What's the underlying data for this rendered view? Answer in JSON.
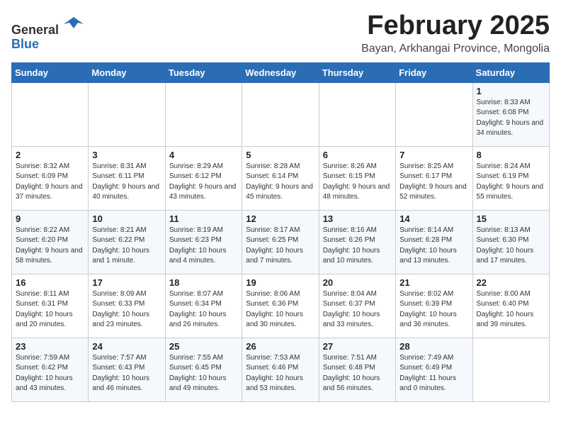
{
  "header": {
    "logo_general": "General",
    "logo_blue": "Blue",
    "month_title": "February 2025",
    "location": "Bayan, Arkhangai Province, Mongolia"
  },
  "days_of_week": [
    "Sunday",
    "Monday",
    "Tuesday",
    "Wednesday",
    "Thursday",
    "Friday",
    "Saturday"
  ],
  "weeks": [
    [
      {
        "day": "",
        "info": ""
      },
      {
        "day": "",
        "info": ""
      },
      {
        "day": "",
        "info": ""
      },
      {
        "day": "",
        "info": ""
      },
      {
        "day": "",
        "info": ""
      },
      {
        "day": "",
        "info": ""
      },
      {
        "day": "1",
        "info": "Sunrise: 8:33 AM\nSunset: 6:08 PM\nDaylight: 9 hours and 34 minutes."
      }
    ],
    [
      {
        "day": "2",
        "info": "Sunrise: 8:32 AM\nSunset: 6:09 PM\nDaylight: 9 hours and 37 minutes."
      },
      {
        "day": "3",
        "info": "Sunrise: 8:31 AM\nSunset: 6:11 PM\nDaylight: 9 hours and 40 minutes."
      },
      {
        "day": "4",
        "info": "Sunrise: 8:29 AM\nSunset: 6:12 PM\nDaylight: 9 hours and 43 minutes."
      },
      {
        "day": "5",
        "info": "Sunrise: 8:28 AM\nSunset: 6:14 PM\nDaylight: 9 hours and 45 minutes."
      },
      {
        "day": "6",
        "info": "Sunrise: 8:26 AM\nSunset: 6:15 PM\nDaylight: 9 hours and 48 minutes."
      },
      {
        "day": "7",
        "info": "Sunrise: 8:25 AM\nSunset: 6:17 PM\nDaylight: 9 hours and 52 minutes."
      },
      {
        "day": "8",
        "info": "Sunrise: 8:24 AM\nSunset: 6:19 PM\nDaylight: 9 hours and 55 minutes."
      }
    ],
    [
      {
        "day": "9",
        "info": "Sunrise: 8:22 AM\nSunset: 6:20 PM\nDaylight: 9 hours and 58 minutes."
      },
      {
        "day": "10",
        "info": "Sunrise: 8:21 AM\nSunset: 6:22 PM\nDaylight: 10 hours and 1 minute."
      },
      {
        "day": "11",
        "info": "Sunrise: 8:19 AM\nSunset: 6:23 PM\nDaylight: 10 hours and 4 minutes."
      },
      {
        "day": "12",
        "info": "Sunrise: 8:17 AM\nSunset: 6:25 PM\nDaylight: 10 hours and 7 minutes."
      },
      {
        "day": "13",
        "info": "Sunrise: 8:16 AM\nSunset: 6:26 PM\nDaylight: 10 hours and 10 minutes."
      },
      {
        "day": "14",
        "info": "Sunrise: 8:14 AM\nSunset: 6:28 PM\nDaylight: 10 hours and 13 minutes."
      },
      {
        "day": "15",
        "info": "Sunrise: 8:13 AM\nSunset: 6:30 PM\nDaylight: 10 hours and 17 minutes."
      }
    ],
    [
      {
        "day": "16",
        "info": "Sunrise: 8:11 AM\nSunset: 6:31 PM\nDaylight: 10 hours and 20 minutes."
      },
      {
        "day": "17",
        "info": "Sunrise: 8:09 AM\nSunset: 6:33 PM\nDaylight: 10 hours and 23 minutes."
      },
      {
        "day": "18",
        "info": "Sunrise: 8:07 AM\nSunset: 6:34 PM\nDaylight: 10 hours and 26 minutes."
      },
      {
        "day": "19",
        "info": "Sunrise: 8:06 AM\nSunset: 6:36 PM\nDaylight: 10 hours and 30 minutes."
      },
      {
        "day": "20",
        "info": "Sunrise: 8:04 AM\nSunset: 6:37 PM\nDaylight: 10 hours and 33 minutes."
      },
      {
        "day": "21",
        "info": "Sunrise: 8:02 AM\nSunset: 6:39 PM\nDaylight: 10 hours and 36 minutes."
      },
      {
        "day": "22",
        "info": "Sunrise: 8:00 AM\nSunset: 6:40 PM\nDaylight: 10 hours and 39 minutes."
      }
    ],
    [
      {
        "day": "23",
        "info": "Sunrise: 7:59 AM\nSunset: 6:42 PM\nDaylight: 10 hours and 43 minutes."
      },
      {
        "day": "24",
        "info": "Sunrise: 7:57 AM\nSunset: 6:43 PM\nDaylight: 10 hours and 46 minutes."
      },
      {
        "day": "25",
        "info": "Sunrise: 7:55 AM\nSunset: 6:45 PM\nDaylight: 10 hours and 49 minutes."
      },
      {
        "day": "26",
        "info": "Sunrise: 7:53 AM\nSunset: 6:46 PM\nDaylight: 10 hours and 53 minutes."
      },
      {
        "day": "27",
        "info": "Sunrise: 7:51 AM\nSunset: 6:48 PM\nDaylight: 10 hours and 56 minutes."
      },
      {
        "day": "28",
        "info": "Sunrise: 7:49 AM\nSunset: 6:49 PM\nDaylight: 11 hours and 0 minutes."
      },
      {
        "day": "",
        "info": ""
      }
    ]
  ]
}
